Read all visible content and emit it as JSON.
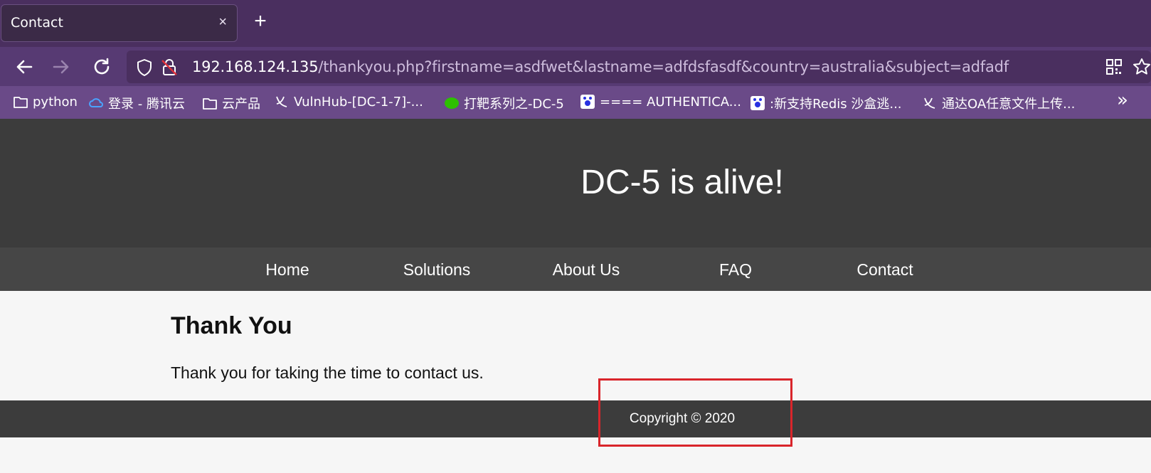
{
  "browser": {
    "tab_title": "Contact",
    "close_glyph": "×",
    "new_tab_glyph": "+",
    "url_host": "192.168.124.135",
    "url_path": "/thankyou.php?firstname=asdfwet&lastname=adfdsfasdf&country=australia&subject=adfadf",
    "bookmarks": [
      {
        "label": "python",
        "icon": "folder-icon"
      },
      {
        "label": "登录 - 腾讯云",
        "icon": "cloud-icon"
      },
      {
        "label": "云产品",
        "icon": "folder-icon"
      },
      {
        "label": "VulnHub-[DC-1-7]-...",
        "icon": "site-icon"
      },
      {
        "label": "打靶系列之-DC-5",
        "icon": "wechat-icon"
      },
      {
        "label": "==== AUTHENTICA...",
        "icon": "baidu-icon"
      },
      {
        "label": ":新支持Redis 沙盒逃...",
        "icon": "baidu-icon"
      },
      {
        "label": "通达OA任意文件上传...",
        "icon": "site-icon"
      }
    ],
    "more_glyph": "»"
  },
  "site": {
    "title": "DC-5 is alive!",
    "nav": [
      "Home",
      "Solutions",
      "About Us",
      "FAQ",
      "Contact"
    ],
    "heading": "Thank You",
    "message": "Thank you for taking the time to contact us.",
    "footer": "Copyright © 2020"
  },
  "colors": {
    "tabbar": "#4a2f5f",
    "header_bg": "#3c3c3c",
    "nav_bg": "#464646",
    "highlight": "#d9252b"
  }
}
